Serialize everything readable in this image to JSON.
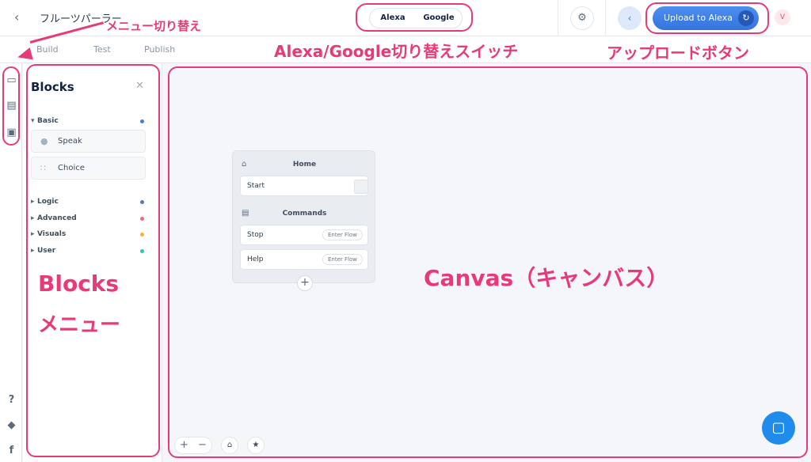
{
  "header": {
    "back_icon": "chevron-left-icon",
    "project_title": "フルーツパーラー",
    "platform_toggle": [
      "Alexa",
      "Google"
    ],
    "settings_icon": "gear-icon",
    "share_icon": "share-icon",
    "upload_label": "Upload to Alexa",
    "sync_icon": "sync-icon",
    "avatar_initial": "V"
  },
  "subnav": {
    "tabs": [
      "Build",
      "Test",
      "Publish"
    ],
    "active": "Build"
  },
  "rail": {
    "top_icons": [
      "display-icon",
      "book-icon",
      "terminal-icon"
    ],
    "bottom_icons": [
      "help-icon",
      "graduation-cap-icon",
      "facebook-icon"
    ]
  },
  "blocks_panel": {
    "title": "Blocks",
    "close_icon": "close-icon",
    "basic": {
      "label": "Basic",
      "color": "#3d82e2",
      "items": [
        {
          "label": "Speak",
          "icon": "speech-bubble-icon"
        },
        {
          "label": "Choice",
          "icon": "branch-icon"
        }
      ]
    },
    "categories": [
      {
        "label": "Logic",
        "color": "#5a6fe0"
      },
      {
        "label": "Advanced",
        "color": "#ef6b78"
      },
      {
        "label": "Visuals",
        "color": "#f3b04a"
      },
      {
        "label": "User",
        "color": "#2cc5bd"
      }
    ]
  },
  "canvas": {
    "flow": {
      "home_title": "Home",
      "start_label": "Start",
      "commands_title": "Commands",
      "commands": [
        {
          "label": "Stop",
          "action": "Enter Flow"
        },
        {
          "label": "Help",
          "action": "Enter Flow"
        }
      ]
    },
    "controls": {
      "zoom_in": "+",
      "zoom_out": "−",
      "home_icon": "home-icon",
      "star_icon": "star-icon"
    },
    "chat_icon": "chat-icon"
  },
  "annotations": {
    "menu_switch": "メニュー切り替え",
    "platform_switch": "Alexa/Google切り替えスイッチ",
    "upload_button": "アップロードボタン",
    "blocks_menu_line1": "Blocks",
    "blocks_menu_line2": "メニュー",
    "canvas": "Canvas（キャンバス）",
    "color": "#e83a78"
  }
}
